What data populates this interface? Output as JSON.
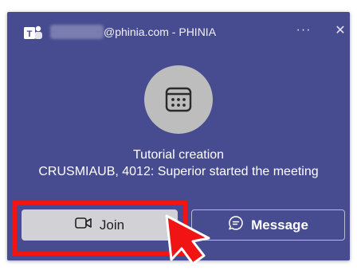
{
  "notification": {
    "sender_email": "@phinia.com - PHINIA",
    "more_label": "···",
    "close_label": "✕",
    "meeting_title": "Tutorial creation",
    "meeting_status": "CRUSMIAUB, 4012: Superior started the meeting",
    "join_label": "Join",
    "message_label": "Message"
  },
  "icons": {
    "app": "teams-logo-icon",
    "avatar": "calendar-icon",
    "join": "video-camera-icon",
    "message": "chat-bubble-icon",
    "cursor": "pointer-arrow-icon"
  },
  "colors": {
    "popup_background": "#464c8f",
    "join_button": "#d2d2d6",
    "highlight": "#f01414",
    "cursor": "#f01414"
  }
}
